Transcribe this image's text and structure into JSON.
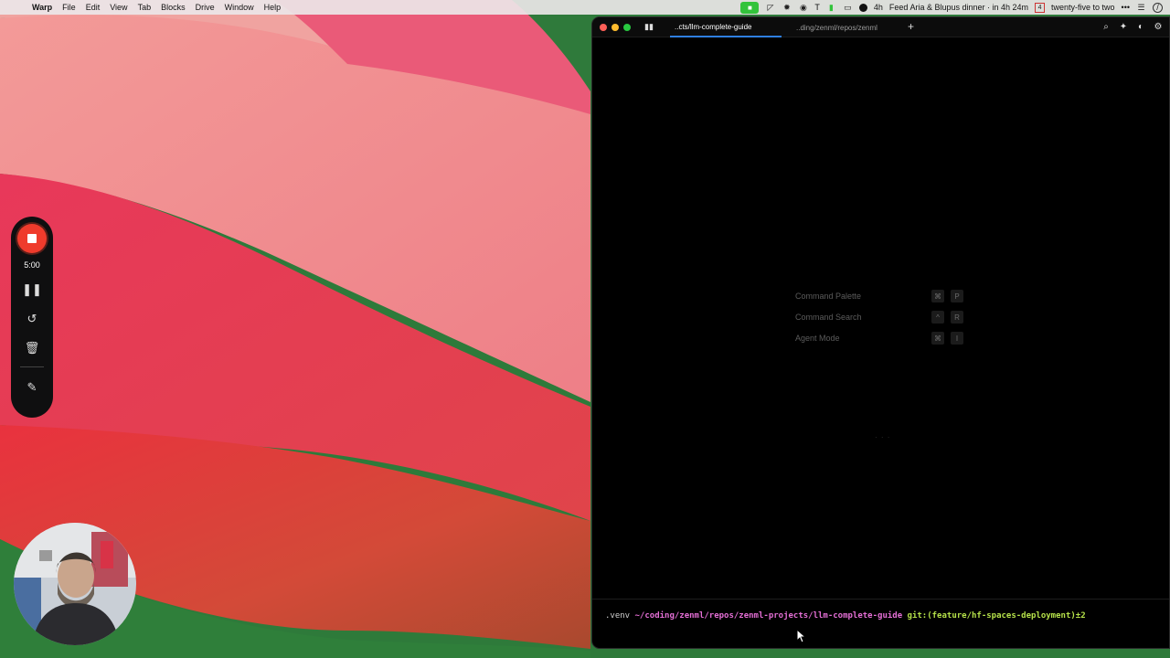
{
  "menubar": {
    "app_name": "Warp",
    "items": [
      "File",
      "Edit",
      "View",
      "Tab",
      "Blocks",
      "Drive",
      "Window",
      "Help"
    ],
    "status_t": "T",
    "status_timer": "4h",
    "event_text": "Feed Aria & Blupus dinner · in 4h 24m",
    "calendar_day": "4",
    "clock_text": "twenty-five to two",
    "more": "•••"
  },
  "recorder": {
    "elapsed": "5:00"
  },
  "terminal": {
    "tabs": [
      {
        "label": "..cts/llm-complete-guide",
        "active": true
      },
      {
        "label": "..ding/zenml/repos/zenml",
        "active": false
      }
    ],
    "new_tab": "+",
    "hints": [
      {
        "label": "Command Palette",
        "keys": [
          "⌘",
          "P"
        ]
      },
      {
        "label": "Command Search",
        "keys": [
          "^",
          "R"
        ]
      },
      {
        "label": "Agent Mode",
        "keys": [
          "⌘",
          "I"
        ]
      }
    ],
    "loading": "· · ·",
    "prompt": {
      "venv": ".venv",
      "path": "~/coding/zenml/repos/zenml-projects/llm-complete-guide",
      "git": "git:(feature/hf-spaces-deployment)±2"
    }
  },
  "colors": {
    "accent_tab": "#2f7fe0",
    "record_red": "#ef3b2c",
    "prompt_path": "#e56fd6",
    "prompt_git": "#b6e24a"
  }
}
